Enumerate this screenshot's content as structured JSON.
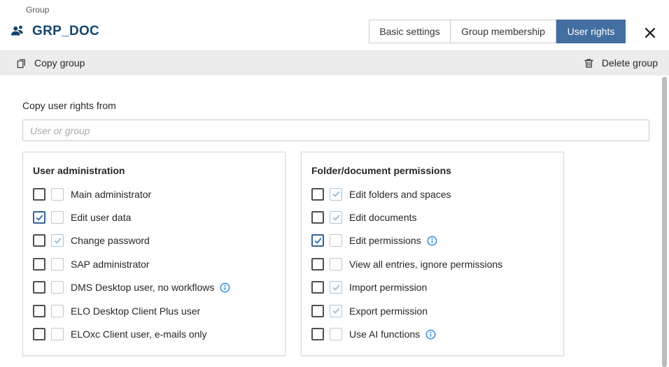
{
  "colors": {
    "accent": "#426f9f",
    "title": "#15466d",
    "check-own": "#3a76b5",
    "check-inh": "#99bfe0",
    "info": "#2e8ae2",
    "toolbar-bg": "#ececec"
  },
  "header": {
    "kicker": "Group",
    "title": "GRP_DOC",
    "tabs": [
      {
        "id": "basic-settings",
        "label": "Basic settings",
        "active": false
      },
      {
        "id": "group-membership",
        "label": "Group membership",
        "active": false
      },
      {
        "id": "user-rights",
        "label": "User rights",
        "active": true
      }
    ]
  },
  "toolbar": {
    "copy_group_label": "Copy group",
    "delete_group_label": "Delete group"
  },
  "form": {
    "copy_rights_label": "Copy user rights from",
    "input_placeholder": "User or group",
    "input_value": ""
  },
  "panels": [
    {
      "title": "User administration",
      "rows": [
        {
          "label": "Main administrator",
          "own": false,
          "inherited": false,
          "info": false
        },
        {
          "label": "Edit user data",
          "own": true,
          "inherited": false,
          "info": false
        },
        {
          "label": "Change password",
          "own": false,
          "inherited": true,
          "info": false
        },
        {
          "label": "SAP administrator",
          "own": false,
          "inherited": false,
          "info": false
        },
        {
          "label": "DMS Desktop user, no workflows",
          "own": false,
          "inherited": false,
          "info": true
        },
        {
          "label": "ELO Desktop Client Plus user",
          "own": false,
          "inherited": false,
          "info": false
        },
        {
          "label": "ELOxc Client user, e-mails only",
          "own": false,
          "inherited": false,
          "info": false
        }
      ]
    },
    {
      "title": "Folder/document permissions",
      "rows": [
        {
          "label": "Edit folders and spaces",
          "own": false,
          "inherited": true,
          "info": false
        },
        {
          "label": "Edit documents",
          "own": false,
          "inherited": true,
          "info": false
        },
        {
          "label": "Edit permissions",
          "own": true,
          "inherited": false,
          "info": true
        },
        {
          "label": "View all entries, ignore permissions",
          "own": false,
          "inherited": false,
          "info": false
        },
        {
          "label": "Import permission",
          "own": false,
          "inherited": true,
          "info": false
        },
        {
          "label": "Export permission",
          "own": false,
          "inherited": true,
          "info": false
        },
        {
          "label": "Use AI functions",
          "own": false,
          "inherited": false,
          "info": true
        }
      ]
    }
  ]
}
